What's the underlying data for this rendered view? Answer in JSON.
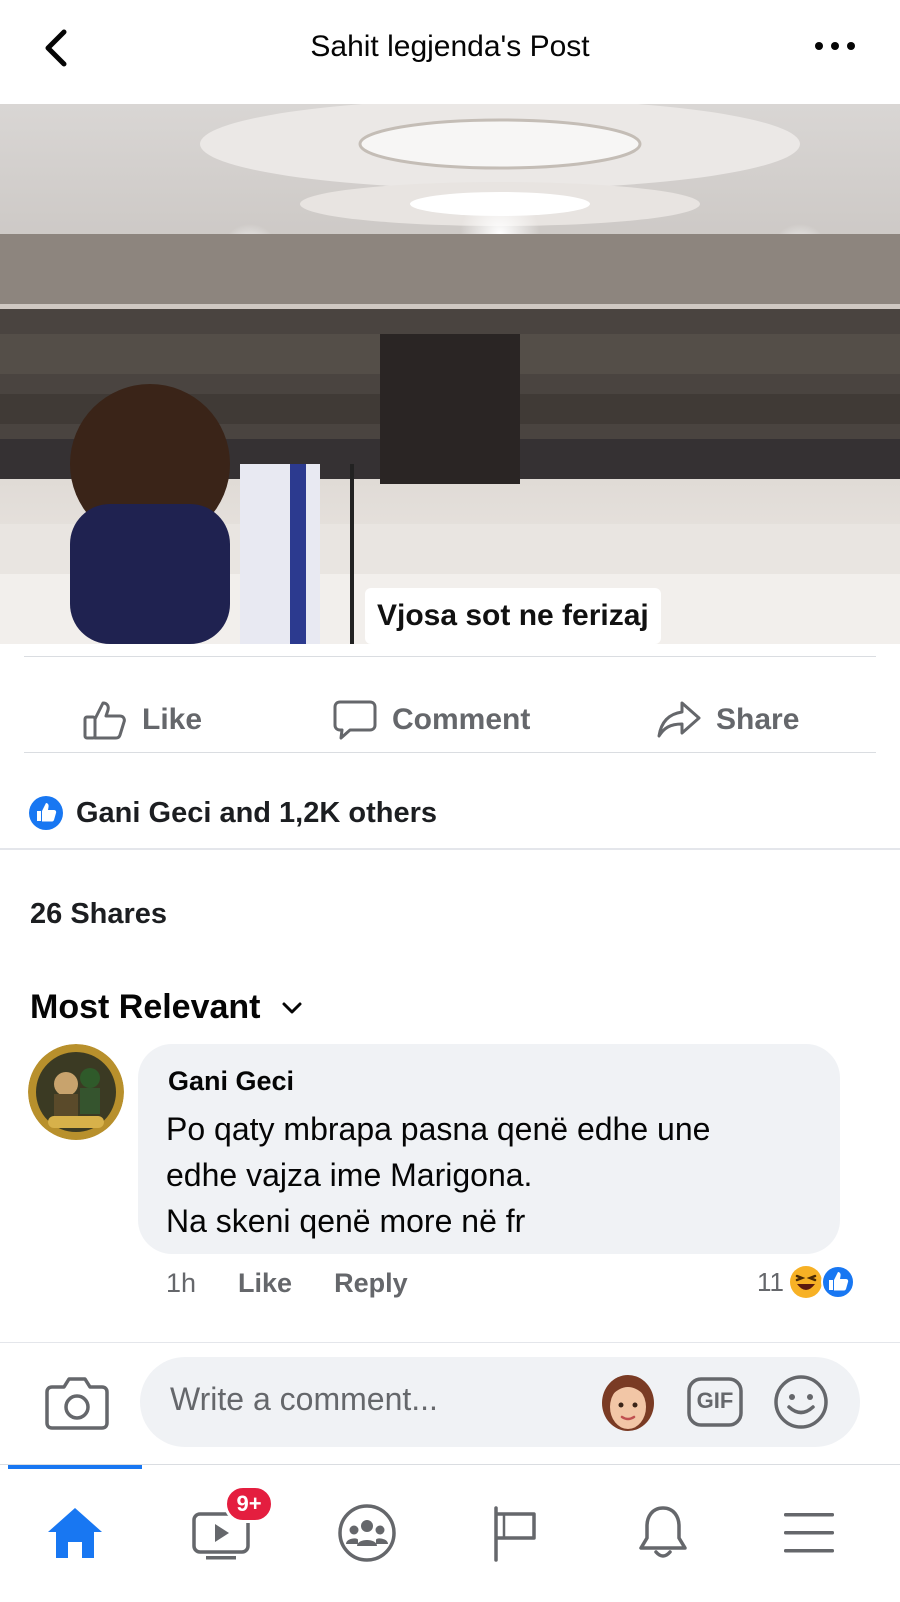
{
  "header": {
    "title": "Sahit legjenda's Post",
    "back_icon": "chevron-left-icon",
    "more_icon": "more-horizontal-icon"
  },
  "post": {
    "photo_caption": "Vjosa sot ne ferizaj",
    "actions": {
      "like": "Like",
      "comment": "Comment",
      "share": "Share"
    },
    "reactions_text": "Gani Geci and 1,2K others",
    "shares_text": "26 Shares"
  },
  "comments": {
    "sort_label": "Most Relevant",
    "items": [
      {
        "author": "Gani Geci",
        "lines": [
          "Po qaty mbrapa pasna qenë edhe une",
          "edhe vajza ime Marigona.",
          "Na skeni qenë more në fr"
        ],
        "time": "1h",
        "like_label": "Like",
        "reply_label": "Reply",
        "reaction_count": "11",
        "reaction_icons": [
          "haha-icon",
          "like-reaction-icon"
        ]
      }
    ]
  },
  "composer": {
    "placeholder": "Write a comment...",
    "gif_label": "GIF"
  },
  "bottom_nav": {
    "tabs": [
      "home",
      "watch",
      "groups",
      "pages",
      "notifications",
      "menu"
    ],
    "watch_badge": "9+",
    "active_tab": "home"
  },
  "colors": {
    "brand_blue": "#1877f2",
    "badge_red": "#e41e3f",
    "secondary_text": "#65676b",
    "bubble_bg": "#f0f2f5"
  }
}
